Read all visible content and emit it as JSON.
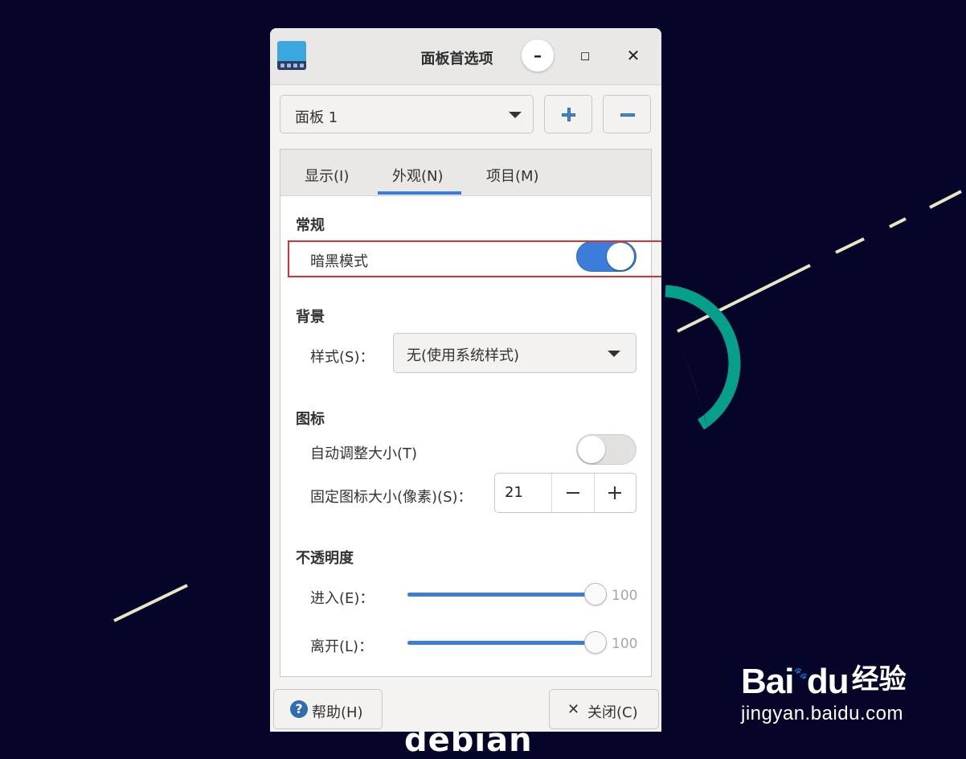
{
  "window": {
    "title": "面板首选项",
    "icon": "panel-icon",
    "controls": {
      "minimize": "–",
      "maximize": "◻",
      "close": "✕"
    }
  },
  "panel_selector": {
    "value": "面板 1",
    "add_icon": "plus-icon",
    "remove_icon": "minus-icon"
  },
  "tabs": [
    {
      "label": "显示(I)",
      "active": false
    },
    {
      "label": "外观(N)",
      "active": true
    },
    {
      "label": "项目(M)",
      "active": false
    }
  ],
  "general": {
    "heading": "常规",
    "dark_mode_label": "暗黑模式",
    "dark_mode_on": true
  },
  "background": {
    "heading": "背景",
    "style_label": "样式(S)：",
    "style_value": "无(使用系统样式)"
  },
  "icons": {
    "heading": "图标",
    "auto_size_label": "自动调整大小(T)",
    "auto_size_on": false,
    "fixed_size_label": "固定图标大小(像素)(S)：",
    "fixed_size_value": "21",
    "minus": "−",
    "plus": "+"
  },
  "opacity": {
    "heading": "不透明度",
    "enter_label": "进入(E)：",
    "enter_value": "100",
    "leave_label": "离开(L)：",
    "leave_value": "100"
  },
  "buttons": {
    "help": "帮助(H)",
    "help_icon": "?",
    "close": "关闭(C)",
    "close_icon": "✕"
  },
  "desktop": {
    "watermark_logo": "Bai",
    "watermark_logo_tail": "du",
    "watermark_cn": "经验",
    "watermark_url": "jingyan.baidu.com",
    "distro_text": "debian"
  },
  "colors": {
    "accent": "#3b7dd8",
    "highlight_border": "#e03030",
    "desktop_bg": "#05052a"
  }
}
